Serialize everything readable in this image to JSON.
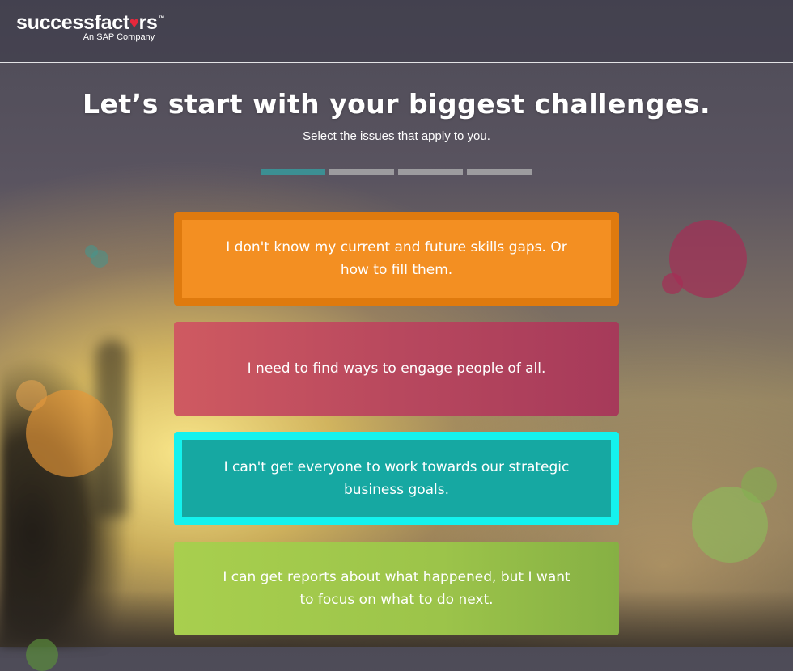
{
  "header": {
    "logo_text": "successfactors",
    "logo_sub": "An SAP Company"
  },
  "page": {
    "title": "Let’s start with your biggest challenges.",
    "subtitle": "Select the issues that apply to you."
  },
  "progress": {
    "steps": 4,
    "current_step": 1
  },
  "options": [
    {
      "text": "I don't know my current and future skills gaps. Or how to fill them.",
      "color": "#f38f22",
      "selected": true
    },
    {
      "text": "I need to find ways to engage people of all.",
      "color": "#b8485e",
      "selected": false
    },
    {
      "text": "I can't get everyone to work towards our strategic business goals.",
      "color": "#16a8a2",
      "selected": true
    },
    {
      "text": "I can get reports about what happened, but I want to focus on what to do next.",
      "color": "#9cc44a",
      "selected": false
    }
  ],
  "colors": {
    "brand_heart": "#e8283c",
    "progress_active": "#3c8f93",
    "teal_highlight": "#14f2ee"
  }
}
